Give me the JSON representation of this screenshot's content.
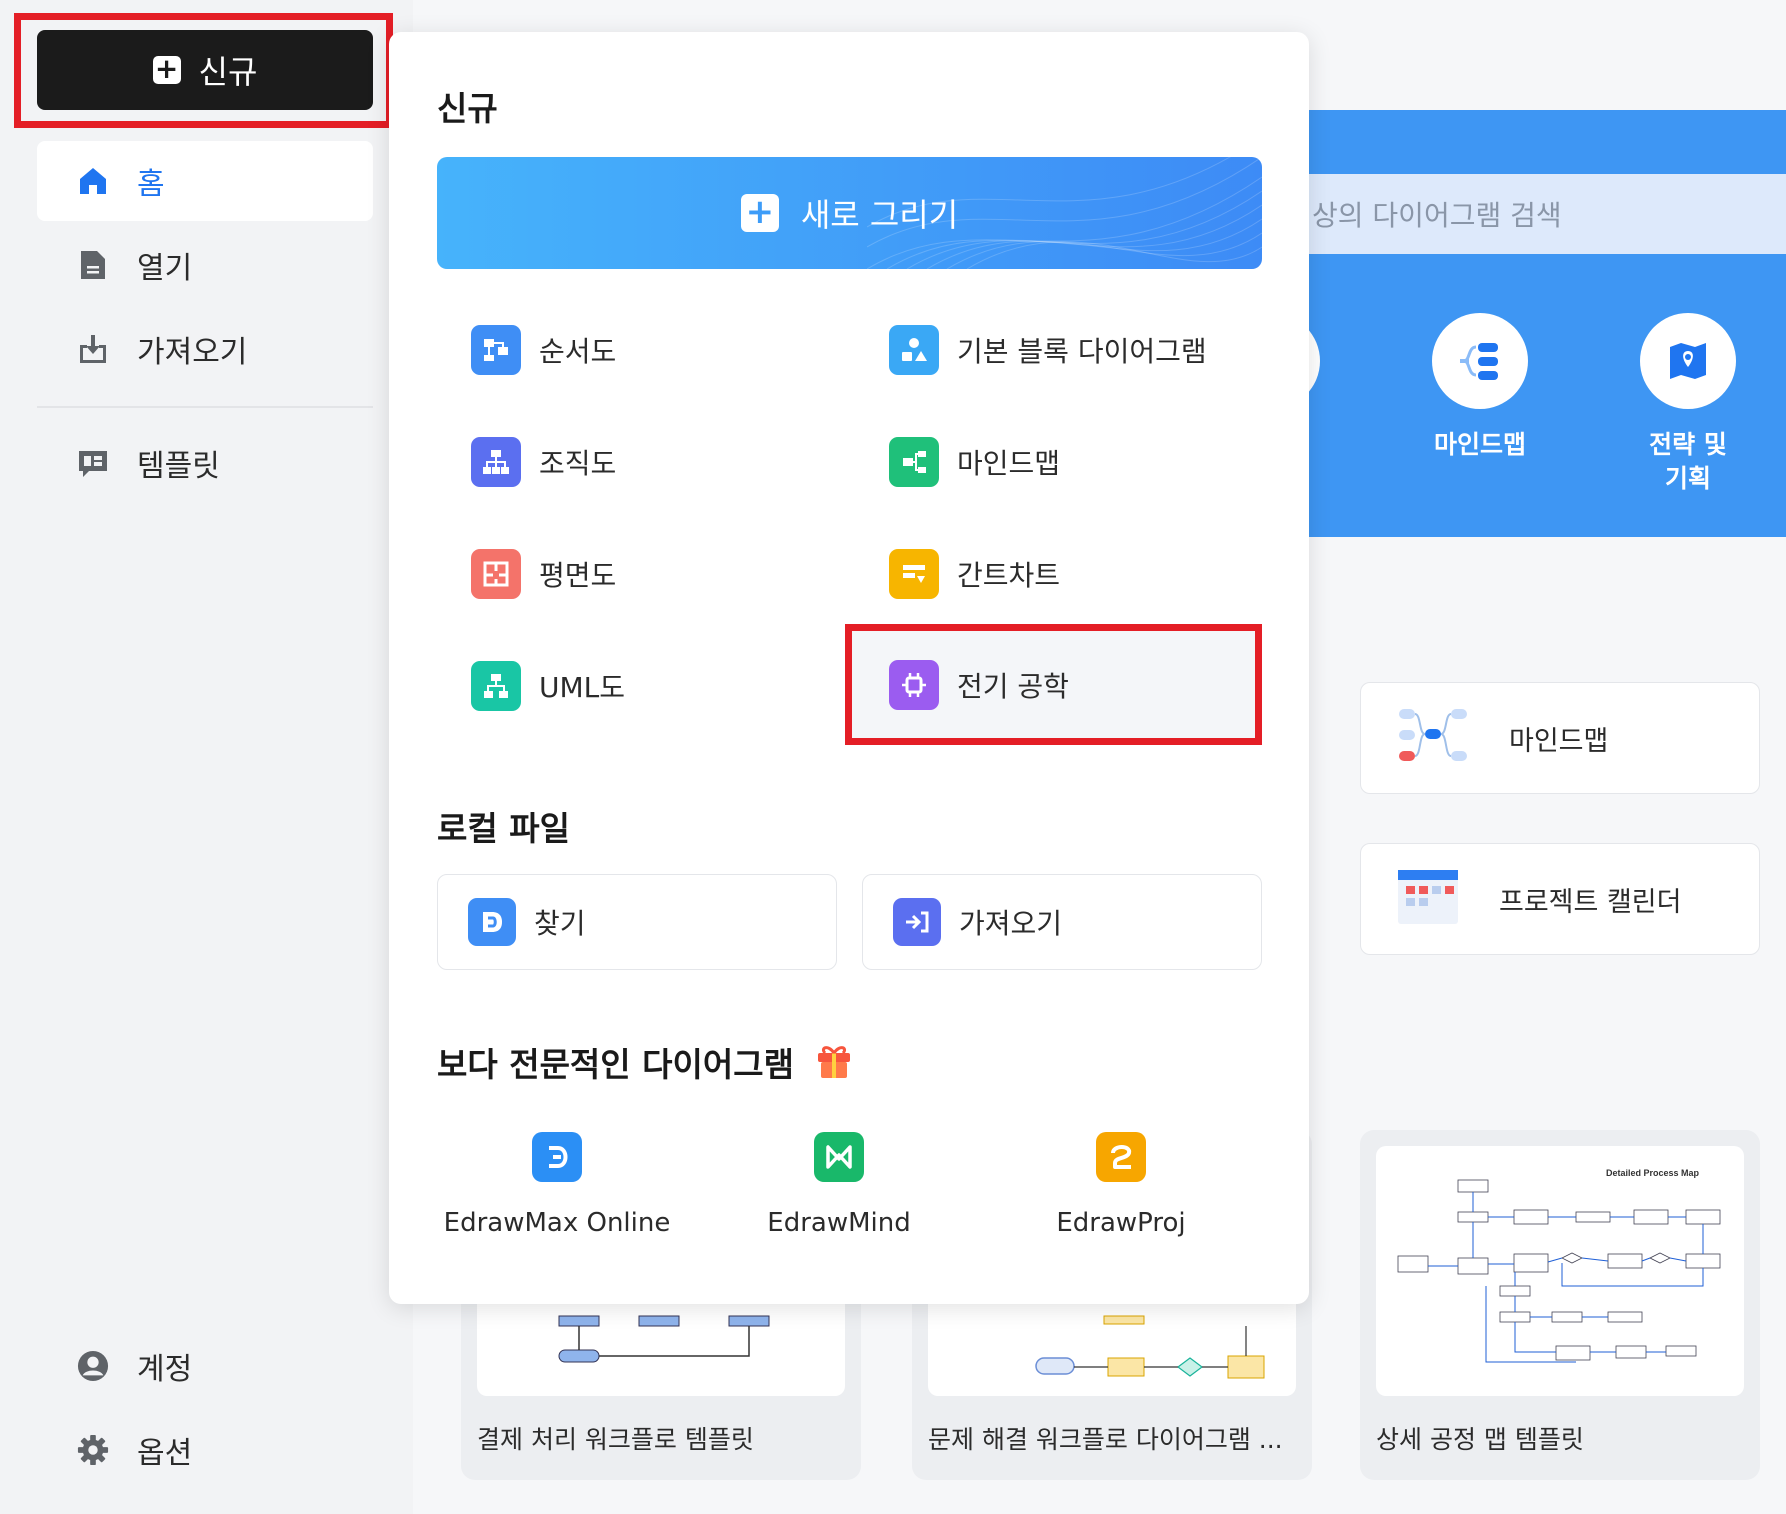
{
  "sidebar": {
    "new_label": "신규",
    "items": [
      {
        "label": "홈",
        "icon": "home-icon"
      },
      {
        "label": "열기",
        "icon": "file-icon"
      },
      {
        "label": "가져오기",
        "icon": "import-icon"
      },
      {
        "label": "템플릿",
        "icon": "template-icon"
      }
    ],
    "bottom": [
      {
        "label": "계정",
        "icon": "account-icon"
      },
      {
        "label": "옵션",
        "icon": "gear-icon"
      }
    ]
  },
  "main": {
    "search_placeholder": "상의 다이어그램 검색",
    "banner_items": [
      {
        "label": "마인드맵",
        "icon": "mindmap-icon"
      },
      {
        "label": "전략 및\n기획",
        "icon": "map-icon"
      }
    ],
    "quick_cards": [
      "마인드맵",
      "프로젝트 캘린더"
    ],
    "templates": [
      "결제 처리 워크플로 템플릿",
      "문제 해결 워크플로 다이어그램 ...",
      "상세 공정 맵 템플릿"
    ],
    "template_thumb_title": "Detailed Process Map"
  },
  "panel": {
    "title": "신규",
    "draw_new": "새로 그리기",
    "types": [
      {
        "label": "순서도",
        "color": "#3f8ef5",
        "icon": "flowchart-icon"
      },
      {
        "label": "기본 블록 다이어그램",
        "color": "#3aa8f5",
        "icon": "block-diagram-icon"
      },
      {
        "label": "조직도",
        "color": "#5b6ff0",
        "icon": "org-chart-icon"
      },
      {
        "label": "마인드맵",
        "color": "#1fc07a",
        "icon": "mindmap-icon"
      },
      {
        "label": "평면도",
        "color": "#f4736a",
        "icon": "floor-plan-icon"
      },
      {
        "label": "간트차트",
        "color": "#f7b500",
        "icon": "gantt-icon"
      },
      {
        "label": "UML도",
        "color": "#19c6a5",
        "icon": "uml-icon"
      },
      {
        "label": "전기 공학",
        "color": "#9b5cf0",
        "icon": "electrical-icon"
      }
    ],
    "local_title": "로컬 파일",
    "local": [
      {
        "label": "찾기",
        "color": "#3f8ef5",
        "icon": "browse-icon"
      },
      {
        "label": "가져오기",
        "color": "#5b6ff0",
        "icon": "import-icon"
      }
    ],
    "pro_title": "보다 전문적인 다이어그램",
    "products": [
      {
        "label": "EdrawMax Online",
        "color": "#2b8ff5"
      },
      {
        "label": "EdrawMind",
        "color": "#19b86a"
      },
      {
        "label": "EdrawProj",
        "color": "#f7a600"
      }
    ]
  }
}
